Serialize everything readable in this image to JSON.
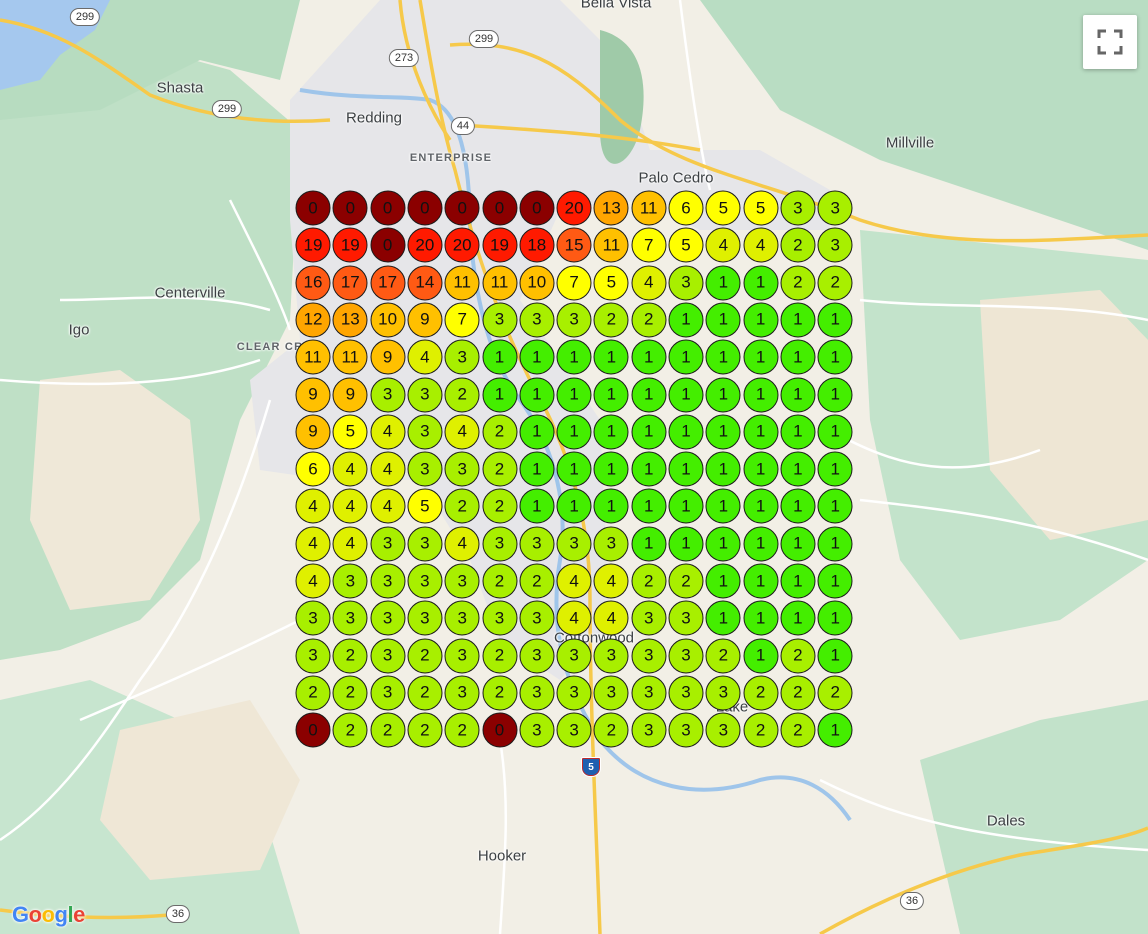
{
  "places": [
    {
      "id": "bella-vista",
      "label": "Bella Vista"
    },
    {
      "id": "shasta",
      "label": "Shasta"
    },
    {
      "id": "redding",
      "label": "Redding"
    },
    {
      "id": "enterprise",
      "label": "ENTERPRISE"
    },
    {
      "id": "palo-cedro",
      "label": "Palo Cedro"
    },
    {
      "id": "millville",
      "label": "Millville"
    },
    {
      "id": "centerville",
      "label": "Centerville"
    },
    {
      "id": "igo",
      "label": "Igo"
    },
    {
      "id": "clear-creek",
      "label": "CLEAR CR"
    },
    {
      "id": "cottonwood",
      "label": "Cottonwood"
    },
    {
      "id": "hooker",
      "label": "Hooker"
    },
    {
      "id": "dales",
      "label": "Dales"
    },
    {
      "id": "lake",
      "label": "Lake"
    },
    {
      "id": "bella-vista-partial",
      "label": ""
    }
  ],
  "highways": {
    "h299a": "299",
    "h299b": "299",
    "h299c": "299",
    "h273": "273",
    "h44": "44",
    "h36a": "36",
    "h36b": "36",
    "i5": "5"
  },
  "grid": {
    "rows": [
      [
        0,
        0,
        0,
        0,
        0,
        0,
        0,
        20,
        13,
        11,
        6,
        5,
        5,
        3,
        3
      ],
      [
        19,
        19,
        0,
        20,
        20,
        19,
        18,
        15,
        11,
        7,
        5,
        4,
        4,
        2,
        3
      ],
      [
        16,
        17,
        17,
        14,
        11,
        11,
        10,
        7,
        5,
        4,
        3,
        1,
        1,
        2,
        2
      ],
      [
        12,
        13,
        10,
        9,
        7,
        3,
        3,
        3,
        2,
        2,
        1,
        1,
        1,
        1,
        1
      ],
      [
        11,
        11,
        9,
        4,
        3,
        1,
        1,
        1,
        1,
        1,
        1,
        1,
        1,
        1,
        1
      ],
      [
        9,
        9,
        3,
        3,
        2,
        1,
        1,
        1,
        1,
        1,
        1,
        1,
        1,
        1,
        1
      ],
      [
        9,
        5,
        4,
        3,
        4,
        2,
        1,
        1,
        1,
        1,
        1,
        1,
        1,
        1,
        1
      ],
      [
        6,
        4,
        4,
        3,
        3,
        2,
        1,
        1,
        1,
        1,
        1,
        1,
        1,
        1,
        1
      ],
      [
        4,
        4,
        4,
        5,
        2,
        2,
        1,
        1,
        1,
        1,
        1,
        1,
        1,
        1,
        1
      ],
      [
        4,
        4,
        3,
        3,
        4,
        3,
        3,
        3,
        3,
        1,
        1,
        1,
        1,
        1,
        1
      ],
      [
        4,
        3,
        3,
        3,
        3,
        2,
        2,
        4,
        4,
        2,
        2,
        1,
        1,
        1,
        1
      ],
      [
        3,
        3,
        3,
        3,
        3,
        3,
        3,
        4,
        4,
        3,
        3,
        1,
        1,
        1,
        1
      ],
      [
        3,
        2,
        3,
        2,
        3,
        2,
        3,
        3,
        3,
        3,
        3,
        2,
        1,
        2,
        1
      ],
      [
        2,
        2,
        3,
        2,
        3,
        2,
        3,
        3,
        3,
        3,
        3,
        3,
        2,
        2,
        2
      ],
      [
        0,
        2,
        2,
        2,
        2,
        0,
        3,
        3,
        2,
        3,
        3,
        3,
        2,
        2,
        1
      ]
    ]
  },
  "colors": {
    "zero": "#8b0000",
    "red": "#ff1a00",
    "orange_red": "#ff5a14",
    "orange": "#ffa500",
    "amber": "#ffc000",
    "yellow": "#ffff00",
    "yellow_green": "#dff000",
    "lime": "#a8ef00",
    "green": "#44ee00",
    "water": "#a5c8ee",
    "park": "#a8dab5",
    "urban": "#e8e8ea"
  },
  "controls": {
    "fullscreen_icon": "fullscreen-icon"
  },
  "attribution": {
    "logo": "Google"
  }
}
